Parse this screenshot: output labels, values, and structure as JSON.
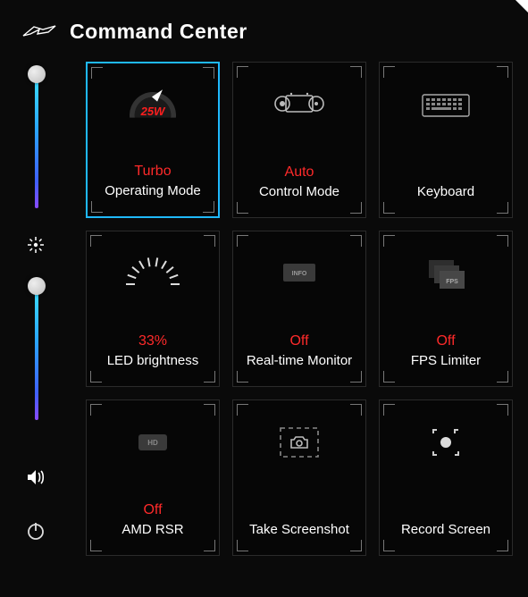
{
  "header": {
    "title": "Command Center"
  },
  "sliders": {
    "top_handle_pct": 5,
    "bottom_handle_pct": 5
  },
  "tiles": [
    {
      "value": "Turbo",
      "label": "Operating Mode",
      "watt": "25W",
      "selected": true
    },
    {
      "value": "Auto",
      "label": "Control Mode"
    },
    {
      "value": "",
      "label": "Keyboard"
    },
    {
      "value": "33%",
      "label": "LED brightness"
    },
    {
      "value": "Off",
      "label": "Real-time Monitor",
      "icon_label": "INFO"
    },
    {
      "value": "Off",
      "label": "FPS Limiter",
      "icon_label": "FPS"
    },
    {
      "value": "Off",
      "label": "AMD RSR",
      "icon_label": "HD"
    },
    {
      "value": "",
      "label": "Take Screenshot"
    },
    {
      "value": "",
      "label": "Record Screen"
    }
  ]
}
